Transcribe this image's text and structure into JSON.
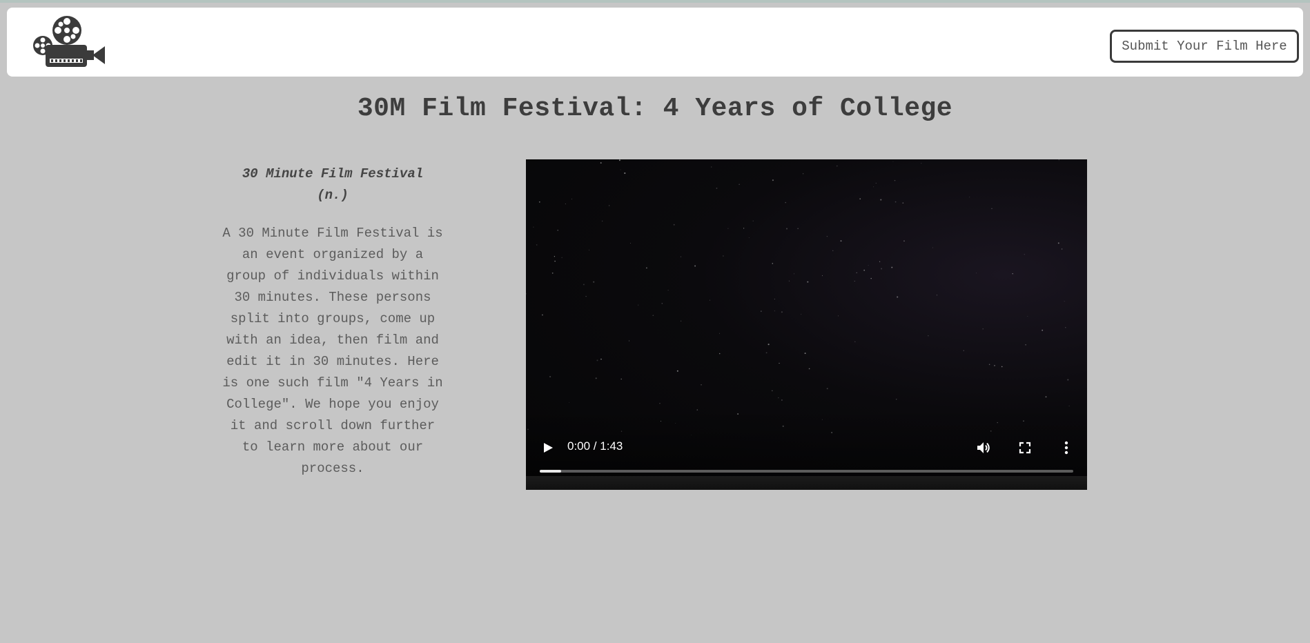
{
  "header": {
    "logo_icon": "film-camera-icon",
    "submit_label": "Submit Your Film Here"
  },
  "main": {
    "title": "30M Film Festival: 4 Years of College",
    "term_line1": "30 Minute Film Festival",
    "term_line2": "(n.)",
    "description": "A 30 Minute Film Festival is an event organized by a group of individuals within 30 minutes. These persons split into groups, come up with an idea, then film and edit it in 30 minutes. Here is one such film \"4 Years in College\". We hope you enjoy it and scroll down further to learn more about our process."
  },
  "video": {
    "time_display": "0:00 / 1:43",
    "progress_fraction": 0.04,
    "icons": [
      "play-icon",
      "volume-icon",
      "fullscreen-icon",
      "more-options-icon"
    ]
  },
  "colors": {
    "background": "#c6c6c6",
    "navbar": "#ffffff",
    "text": "#404040",
    "video_bg": "#0b0a0d"
  }
}
